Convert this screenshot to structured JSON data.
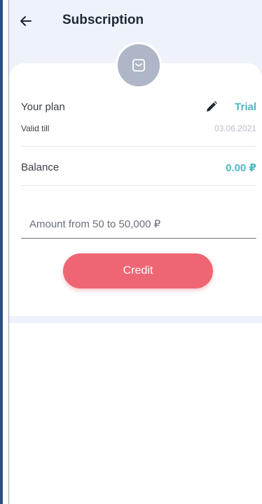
{
  "header": {
    "title": "Subscription",
    "back_icon": "arrow-left-icon"
  },
  "card": {
    "avatar_icon": "shopping-bag-icon",
    "plan": {
      "label": "Your plan",
      "edit_icon": "pencil-icon",
      "value": "Trial"
    },
    "valid": {
      "label": "Valid till",
      "value": "03.06.2021"
    },
    "balance": {
      "label": "Balance",
      "value": "0.00 ₽"
    },
    "amount_input": {
      "placeholder": "Amount from 50 to 50,000 ₽",
      "value": ""
    },
    "credit_label": "Credit"
  },
  "colors": {
    "accent": "#4db8c4",
    "primary_button": "#ee6673",
    "background_band": "#eef2fa"
  }
}
